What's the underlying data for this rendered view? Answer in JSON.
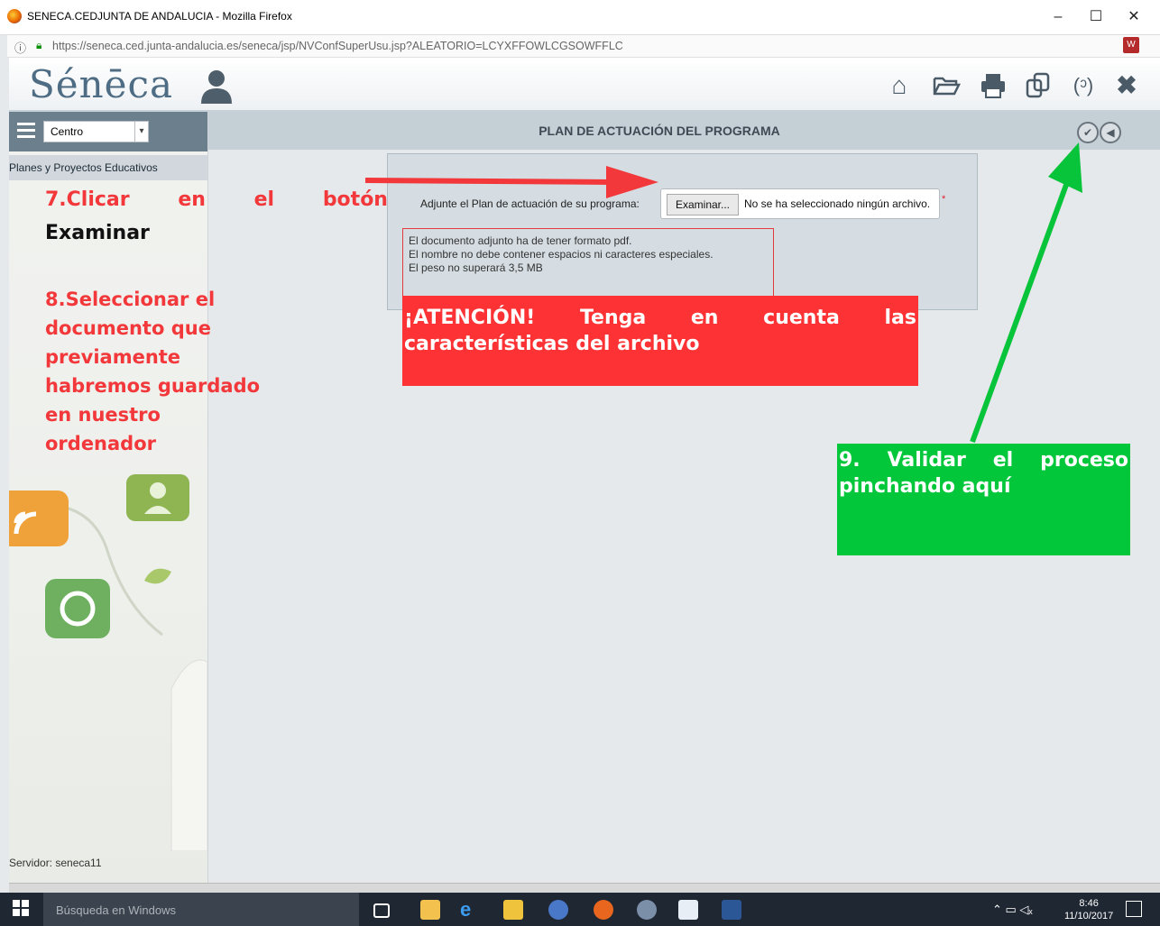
{
  "window": {
    "title": "SENECA.CEDJUNTA DE ANDALUCIA - Mozilla Firefox",
    "minimize": "–",
    "maximize": "☐",
    "close": "✕"
  },
  "browser": {
    "url": "https://seneca.ced.junta-andalucia.es/seneca/jsp/NVConfSuperUsu.jsp?ALEATORIO=LCYXFFOWLCGSOWFFLC"
  },
  "app": {
    "logo": "Sénēca",
    "header_icons": [
      "home-icon",
      "folder-open-icon",
      "print-icon",
      "copy-icon",
      "phone-icon",
      "close-icon"
    ]
  },
  "sidebar": {
    "select_value": "Centro",
    "menu_item": "Planes y Proyectos Educativos",
    "server": "Servidor: seneca11"
  },
  "main": {
    "title": "PLAN DE ACTUACIÓN DEL PROGRAMA",
    "attach_label": "Adjunte el Plan de actuación de su programa:",
    "browse_button": "Examinar...",
    "no_file": "No se ha seleccionado ningún archivo.",
    "required_mark": "*",
    "notes": [
      "El documento adjunto ha de tener formato pdf.",
      "El nombre no debe contener espacios ni caracteres especiales.",
      "El peso no superará 3,5 MB"
    ]
  },
  "annotations": {
    "step7_words": [
      "7.Clicar",
      "en",
      "el",
      "botón"
    ],
    "step7_line2": "Examinar",
    "step8_lines": [
      "8.Seleccionar el",
      "documento que",
      "previamente",
      "habremos guardado",
      "en nuestro",
      "ordenador"
    ],
    "attention_words": [
      "¡ATENCIÓN!",
      "Tenga",
      "en",
      "cuenta",
      "las"
    ],
    "attention_line2": "características del archivo",
    "step9_words": [
      "9.",
      "Validar",
      "el",
      "proceso"
    ],
    "step9_line2": "pinchando aquí",
    "colors": {
      "red": "#fc3234",
      "green": "#02c73a"
    }
  },
  "taskbar": {
    "search": "Búsqueda en Windows",
    "time": "8:46",
    "date": "11/10/2017"
  }
}
